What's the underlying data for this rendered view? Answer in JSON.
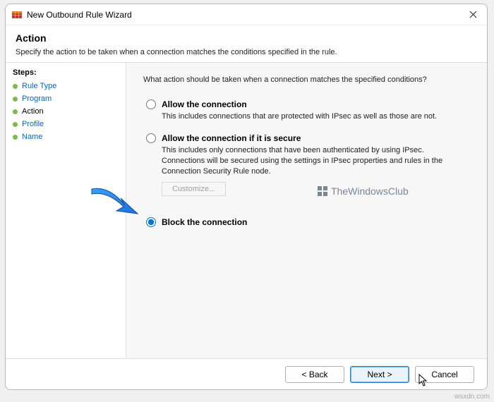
{
  "window": {
    "title": "New Outbound Rule Wizard"
  },
  "header": {
    "title": "Action",
    "description": "Specify the action to be taken when a connection matches the conditions specified in the rule."
  },
  "sidebar": {
    "steps_label": "Steps:",
    "items": [
      {
        "label": "Rule Type"
      },
      {
        "label": "Program"
      },
      {
        "label": "Action"
      },
      {
        "label": "Profile"
      },
      {
        "label": "Name"
      }
    ]
  },
  "content": {
    "question": "What action should be taken when a connection matches the specified conditions?",
    "options": {
      "allow": {
        "label": "Allow the connection",
        "desc": "This includes connections that are protected with IPsec as well as those are not."
      },
      "allow_secure": {
        "label": "Allow the connection if it is secure",
        "desc": "This includes only connections that have been authenticated by using IPsec. Connections will be secured using the settings in IPsec properties and rules in the Connection Security Rule node.",
        "customize": "Customize..."
      },
      "block": {
        "label": "Block the connection"
      }
    },
    "watermark": "TheWindowsClub"
  },
  "footer": {
    "back": "< Back",
    "next": "Next >",
    "cancel": "Cancel"
  },
  "url": "wsxdn.com"
}
